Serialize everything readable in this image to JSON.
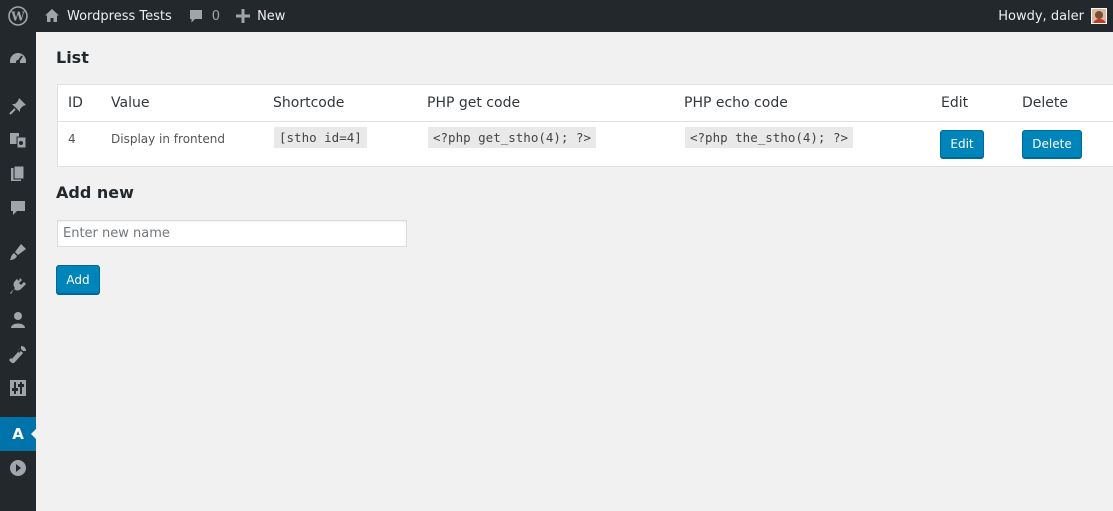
{
  "adminbar": {
    "site_name": "Wordpress Tests",
    "comments_count": "0",
    "new_label": "New",
    "howdy": "Howdy, daler"
  },
  "sidebar": {
    "items": [
      {
        "name": "dashboard-icon"
      },
      {
        "name": "posts-icon"
      },
      {
        "name": "media-icon"
      },
      {
        "name": "pages-icon"
      },
      {
        "name": "comments-icon"
      },
      {
        "name": "appearance-icon"
      },
      {
        "name": "plugins-icon"
      },
      {
        "name": "users-icon"
      },
      {
        "name": "tools-icon"
      },
      {
        "name": "settings-icon"
      },
      {
        "name": "plugin-a-icon",
        "label": "A",
        "active": true
      },
      {
        "name": "collapse-icon"
      }
    ]
  },
  "list": {
    "title": "List",
    "headers": [
      "ID",
      "Value",
      "Shortcode",
      "PHP get code",
      "PHP echo code",
      "Edit",
      "Delete"
    ],
    "rows": [
      {
        "id": "4",
        "value": "Display in frontend",
        "shortcode": "[stho id=4]",
        "php_get": "<?php get_stho(4); ?>",
        "php_echo": "<?php the_stho(4); ?>",
        "edit_label": "Edit",
        "delete_label": "Delete"
      }
    ]
  },
  "add_new": {
    "title": "Add new",
    "placeholder": "Enter new name",
    "value": "",
    "button_label": "Add"
  },
  "colors": {
    "adminbar_bg": "#23282d",
    "accent": "#0073aa",
    "button": "#0085ba",
    "page_bg": "#f1f1f1"
  }
}
